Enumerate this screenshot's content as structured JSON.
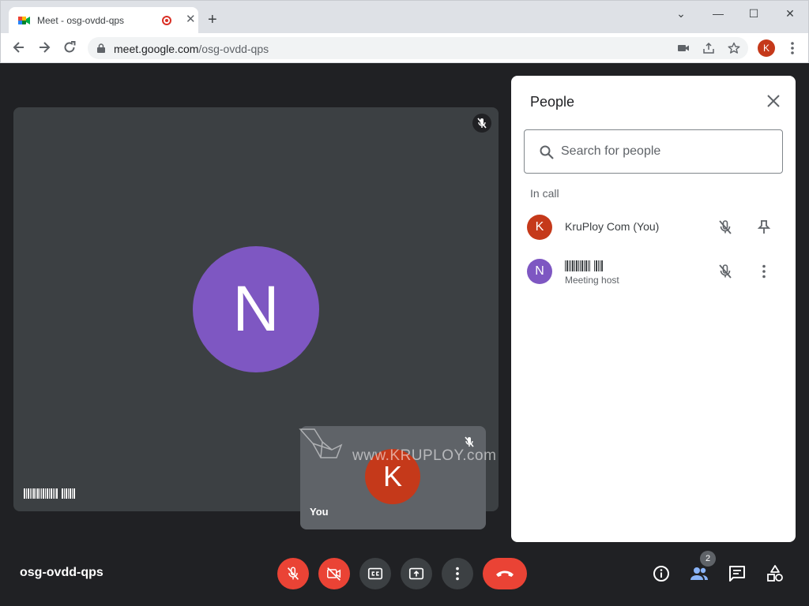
{
  "browser": {
    "tab_title": "Meet - osg-ovdd-qps",
    "tab_close": "✕",
    "new_tab": "+",
    "window_controls": {
      "dropdown": "⌄",
      "minimize": "—",
      "maximize": "☐",
      "close": "✕"
    },
    "url_host": "meet.google.com",
    "url_path": "/osg-ovdd-qps",
    "profile_initial": "K"
  },
  "main_tile": {
    "initial": "N",
    "avatar_color": "#7e57c2",
    "name_barcode": true
  },
  "self_tile": {
    "initial": "K",
    "label": "You",
    "avatar_color": "#c5391a"
  },
  "watermark": "www.KRUPLOY.com",
  "people_panel": {
    "title": "People",
    "search_placeholder": "Search for people",
    "section": "In call",
    "participants": [
      {
        "initial": "K",
        "name": "KruPloy Com (You)",
        "subtitle": "",
        "avatar_color": "#c5391a",
        "action_icon": "pin-icon"
      },
      {
        "initial": "N",
        "name": "",
        "subtitle": "Meeting host",
        "avatar_color": "#7e57c2",
        "action_icon": "more-vert-icon"
      }
    ]
  },
  "bottom_bar": {
    "meeting_code": "osg-ovdd-qps",
    "participant_count": "2",
    "controls": [
      "mic-off-icon",
      "camera-off-icon",
      "captions-icon",
      "present-icon",
      "more-icon",
      "hang-up-icon"
    ],
    "right_controls": [
      "info-icon",
      "people-icon",
      "chat-icon",
      "activities-icon"
    ]
  }
}
